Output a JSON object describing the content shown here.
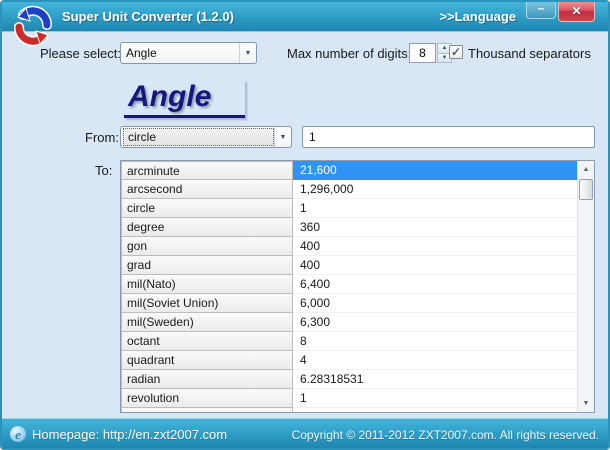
{
  "titlebar": {
    "title": "Super Unit Converter (1.2.0)",
    "language_link": ">>Language"
  },
  "icons": {
    "minimize": "–",
    "close": "✕",
    "dropdown_arrow": "▼",
    "spin_up": "▲",
    "spin_down": "▼",
    "check": "✓",
    "scroll_up": "▲",
    "scroll_down": "▼",
    "ie": "e"
  },
  "controls": {
    "select_label": "Please select:",
    "category": "Angle",
    "digits_label": "Max number of digits:",
    "digits_value": "8",
    "thousand_separators_label": "Thousand separators",
    "thousand_separators_checked": true
  },
  "heading": "Angle",
  "from": {
    "label": "From:",
    "unit": "circle",
    "value": "1"
  },
  "to": {
    "label": "To:",
    "rows": [
      {
        "unit": "arcminute",
        "value": "21,600",
        "selected": true
      },
      {
        "unit": "arcsecond",
        "value": "1,296,000"
      },
      {
        "unit": "circle",
        "value": "1"
      },
      {
        "unit": "degree",
        "value": "360"
      },
      {
        "unit": "gon",
        "value": "400"
      },
      {
        "unit": "grad",
        "value": "400"
      },
      {
        "unit": "mil(Nato)",
        "value": "6,400"
      },
      {
        "unit": "mil(Soviet Union)",
        "value": "6,000"
      },
      {
        "unit": "mil(Sweden)",
        "value": "6,300"
      },
      {
        "unit": "octant",
        "value": "8"
      },
      {
        "unit": "quadrant",
        "value": "4"
      },
      {
        "unit": "radian",
        "value": "6.28318531"
      },
      {
        "unit": "revolution",
        "value": "1"
      }
    ]
  },
  "footer": {
    "homepage": "Homepage: http://en.zxt2007.com",
    "copyright": "Copyright © 2011-2012 ZXT2007.com. All rights reserved."
  },
  "colors": {
    "titlebar_top": "#45b4da",
    "titlebar_bottom": "#1e86b1",
    "content_bg": "#d8e6f6",
    "selection_bg": "#2f93f5",
    "heading_color": "#16167d"
  }
}
